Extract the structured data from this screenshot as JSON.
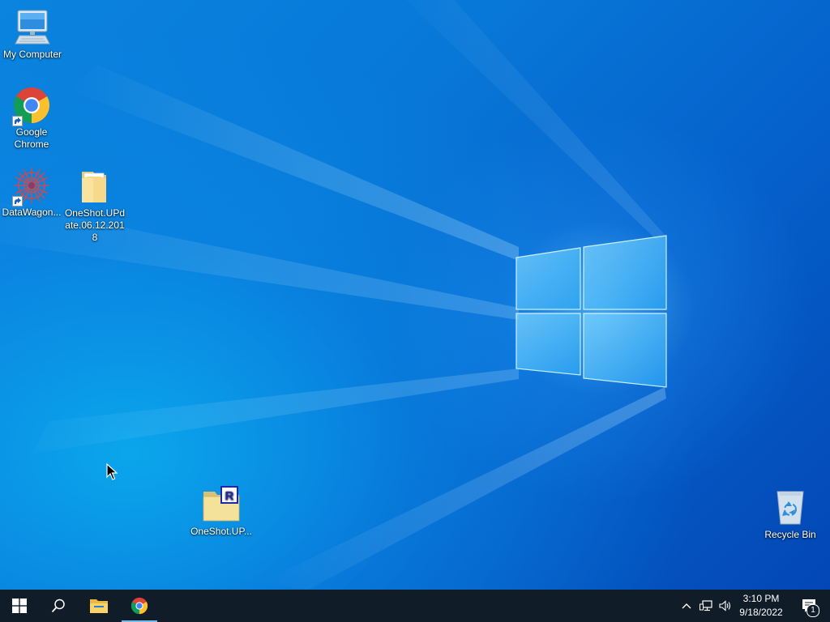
{
  "desktop": {
    "icons": [
      {
        "label": "My Computer",
        "icon": "computer-icon"
      },
      {
        "label": "Google Chrome",
        "icon": "chrome-icon"
      },
      {
        "label": "DataWagon...",
        "icon": "datawagon-icon"
      },
      {
        "label": "OneShot.UPd ate.06.12.2018",
        "icon": "folder-icon"
      },
      {
        "label": "OneShot.UP...",
        "icon": "rar-archive-icon"
      },
      {
        "label": "Recycle Bin",
        "icon": "recycle-bin-icon"
      }
    ]
  },
  "taskbar": {
    "buttons": [
      {
        "name": "start",
        "icon": "windows-start-icon"
      },
      {
        "name": "search",
        "icon": "search-icon"
      },
      {
        "name": "file-explorer",
        "icon": "folder-icon"
      },
      {
        "name": "chrome",
        "icon": "chrome-icon",
        "active": true
      }
    ],
    "tray": {
      "icons": [
        "chevron-up-icon",
        "network-icon",
        "volume-icon"
      ],
      "time": "3:10 PM",
      "date": "9/18/2022",
      "notification_count": "1"
    }
  },
  "colors": {
    "taskbar": "#101c28",
    "desktop_accent": "#0a84de",
    "active_indicator": "#76b9ed"
  }
}
